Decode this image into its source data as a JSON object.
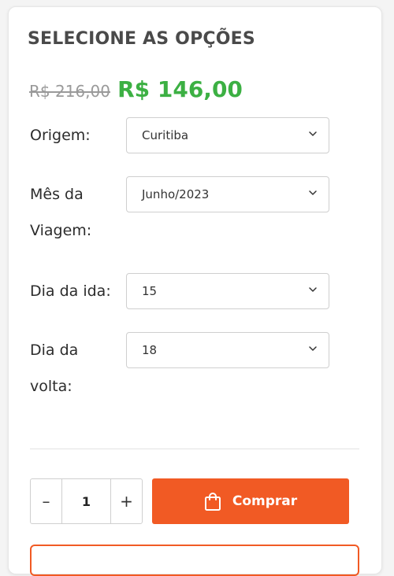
{
  "card": {
    "title": "SELECIONE AS OPÇÕES",
    "old_price": "R$ 216,00",
    "new_price": "R$ 146,00"
  },
  "fields": {
    "origem": {
      "label": "Origem:",
      "value": "Curitiba"
    },
    "mes": {
      "label": "Mês da Viagem:",
      "value": "Junho/2023"
    },
    "ida": {
      "label": "Dia da ida:",
      "value": "15"
    },
    "volta": {
      "label": "Dia da volta:",
      "value": "18"
    }
  },
  "quantity": {
    "minus": "–",
    "value": "1",
    "plus": "+"
  },
  "buy_button": {
    "label": "Comprar",
    "icon": "shopping-bag-icon"
  },
  "colors": {
    "accent": "#f15a24",
    "price_green": "#3cb043",
    "old_price": "#9a9a9a"
  }
}
